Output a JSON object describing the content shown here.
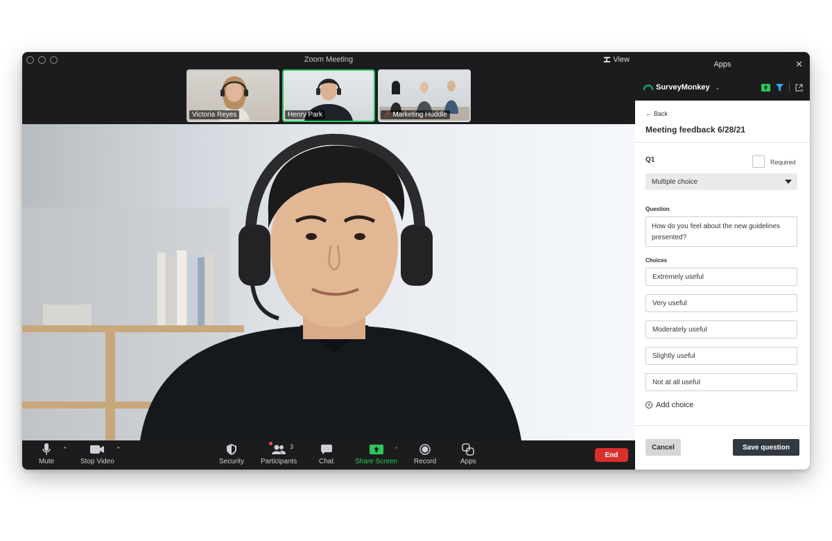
{
  "window": {
    "title": "Zoom Meeting",
    "view_label": "View"
  },
  "thumbnails": [
    {
      "name": "Victoria Reyes",
      "active": false,
      "muted": false
    },
    {
      "name": "Henry Park",
      "active": true,
      "muted": false
    },
    {
      "name": "Marketing Huddle",
      "active": false,
      "muted": true
    }
  ],
  "controls": {
    "mute": "Mute",
    "stop_video": "Stop Video",
    "security": "Security",
    "participants": "Participants",
    "participants_count": "3",
    "chat": "Chat",
    "share_screen": "Share Screen",
    "record": "Record",
    "apps": "Apps",
    "end": "End"
  },
  "apps_panel": {
    "title": "Apps",
    "app_name": "SurveyMonkey",
    "back": "Back",
    "survey_title": "Meeting feedback 6/28/21",
    "question_number": "Q1",
    "required_label": "Required",
    "question_type": "Multiple choice",
    "question_label": "Question",
    "question_text": "How do you feel about the new guidelines presented?",
    "choices_label": "Choices",
    "choices": [
      "Extremely useful",
      "Very useful",
      "Moderately useful",
      "Slightly useful",
      "Not at all useful"
    ],
    "add_choice": "Add choice",
    "cancel": "Cancel",
    "save": "Save question"
  },
  "colors": {
    "accent_green": "#2ac85a",
    "surveymonkey_green": "#00bf6f",
    "end_red": "#d9302c",
    "save_dark": "#323a40"
  }
}
